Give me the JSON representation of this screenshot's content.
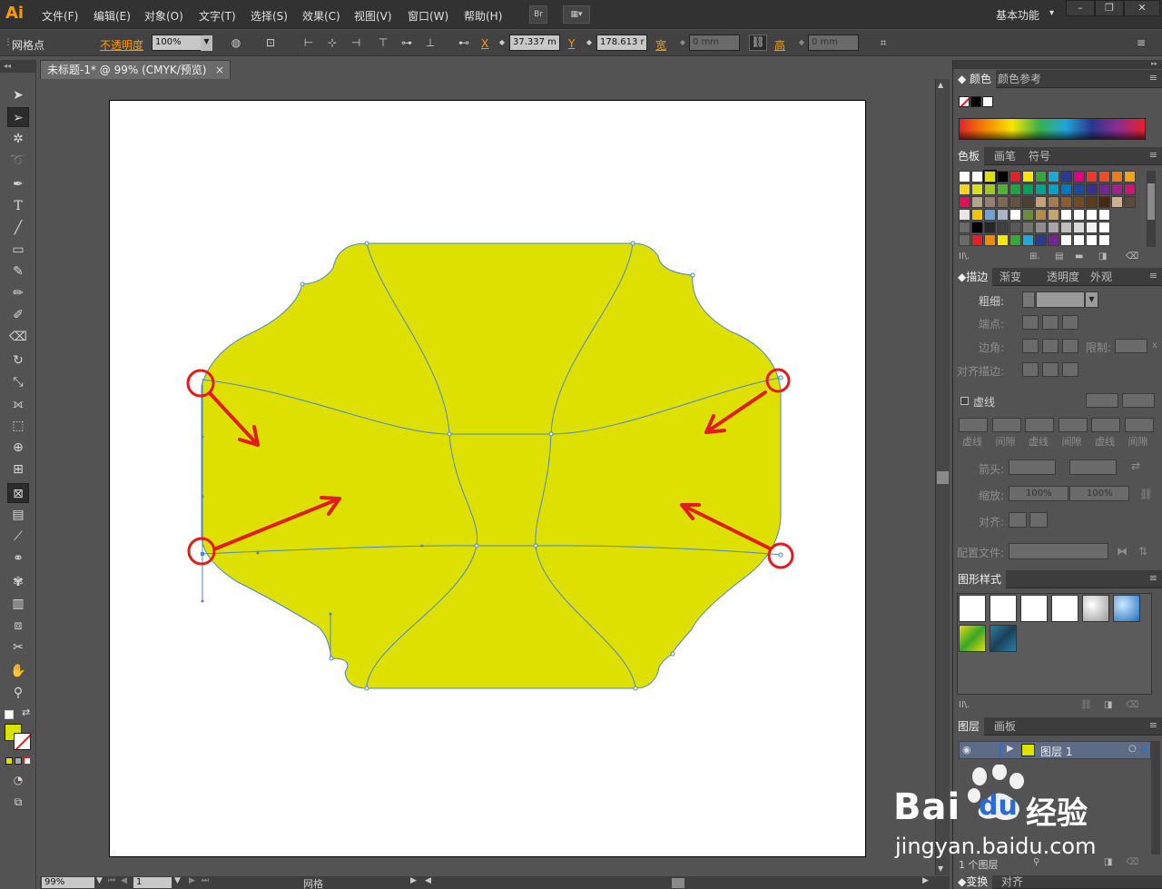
{
  "app": {
    "logo": "Ai",
    "menus": [
      "文件(F)",
      "编辑(E)",
      "对象(O)",
      "文字(T)",
      "选择(S)",
      "效果(C)",
      "视图(V)",
      "窗口(W)",
      "帮助(H)"
    ],
    "bridge_button": "Br",
    "workspace": "基本功能"
  },
  "controlbar": {
    "mode_label": "网格点",
    "opacity_label": "不透明度",
    "opacity_value": "100%",
    "x_label": "X",
    "x_value": "37.337 m",
    "y_label": "Y",
    "y_value": "178.613 r",
    "w_label": "宽",
    "w_value": "0 mm",
    "h_label": "高",
    "h_value": "0 mm"
  },
  "document": {
    "tab_title": "未标题-1* @ 99% (CMYK/预览)",
    "tab_close": "×",
    "zoom": "99%",
    "page": "1",
    "status": "网格"
  },
  "colors": {
    "fill": "#dde000",
    "mesh_line": "#4a86c8",
    "annotation": "#e41b1b",
    "brand": "#ff9a00"
  },
  "panels": {
    "color_tabs": [
      "颜色",
      "颜色参考"
    ],
    "swatch_tabs": [
      "色板",
      "画笔",
      "符号"
    ],
    "stroke_tabs": [
      "描边",
      "渐变",
      "透明度",
      "外观"
    ],
    "stroke": {
      "weight": "粗细:",
      "cap": "端点:",
      "corner": "边角:",
      "limit": "限制:",
      "limit_x": "x",
      "align": "对齐描边:",
      "dashed": "虚线",
      "dash_labels": [
        "虚线",
        "间隙",
        "虚线",
        "间隙",
        "虚线",
        "间隙"
      ],
      "arrowheads": "箭头:",
      "scale": "缩放:",
      "scale_1": "100%",
      "scale_2": "100%",
      "align2": "对齐:",
      "profile": "配置文件:"
    },
    "graphic_styles_tab": "图形样式",
    "layers_tabs": [
      "图层",
      "画板"
    ],
    "layer_name": "图层 1",
    "layer_count": "1 个图层",
    "bottom_tabs": [
      "变换",
      "对齐"
    ]
  },
  "watermark": {
    "brand_1": "Bai",
    "brand_2": "du",
    "cn": "经验",
    "url": "jingyan.baidu.com"
  }
}
